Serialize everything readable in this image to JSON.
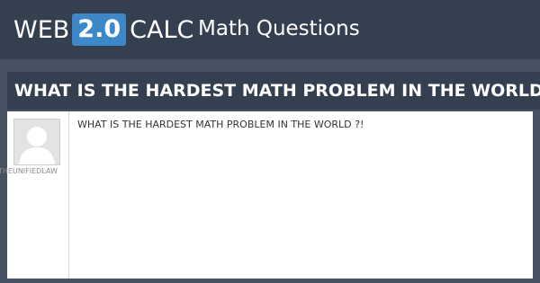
{
  "header": {
    "logo": {
      "prefix": "WEB",
      "badge": "2.0",
      "suffix": "CALC"
    },
    "section_title": "Math Questions"
  },
  "question": {
    "title": "WHAT IS THE HARDEST MATH PROBLEM IN THE WORLD ?!",
    "body": "WHAT IS THE HARDEST MATH PROBLEM IN THE WORLD ?!",
    "author": "THEUNIFIEDLAW",
    "avatar_icon": "user-avatar-placeholder"
  },
  "colors": {
    "page_background": "#465261",
    "header_background": "#34404f",
    "badge_background": "#3c88c8",
    "card_background": "#ffffff"
  }
}
